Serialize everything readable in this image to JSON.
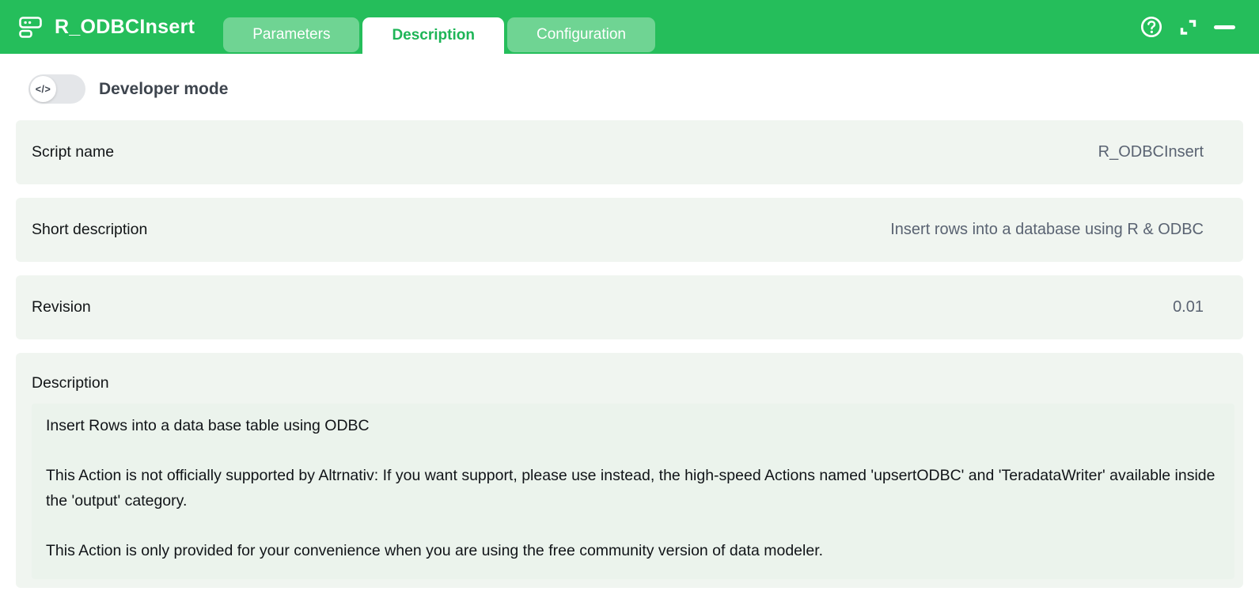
{
  "header": {
    "title": "R_ODBCInsert",
    "tabs": [
      {
        "label": "Parameters",
        "active": false
      },
      {
        "label": "Description",
        "active": true
      },
      {
        "label": "Configuration",
        "active": false
      }
    ],
    "window_controls": [
      "help",
      "expand",
      "minimize"
    ]
  },
  "developer_mode": {
    "label": "Developer mode",
    "enabled": false,
    "knob_glyph": "</>"
  },
  "fields": [
    {
      "label": "Script name",
      "value": "R_ODBCInsert"
    },
    {
      "label": "Short description",
      "value": "Insert rows into a database using R & ODBC"
    },
    {
      "label": "Revision",
      "value": "0.01"
    }
  ],
  "description": {
    "label": "Description",
    "paragraphs": [
      "Insert Rows into a data base table using ODBC",
      "This Action is not officially supported by Altrnativ: If you want support, please use instead, the high-speed Actions named 'upsertODBC' and 'TeradataWriter' available inside the 'output' category.",
      "This Action is only provided for your convenience when you are using the free community version of data modeler."
    ]
  },
  "colors": {
    "accent_green": "#25be5b",
    "active_tab_text": "#1eb557",
    "inactive_tab_bg": "rgba(255,255,255,0.34)",
    "row_background": "#f0f5f0",
    "description_area_background": "#ebf3ec",
    "label_text": "#121517",
    "value_text": "#5a6372",
    "devmode_label_text": "#3e454e",
    "toggle_track": "#e4e6e9"
  }
}
